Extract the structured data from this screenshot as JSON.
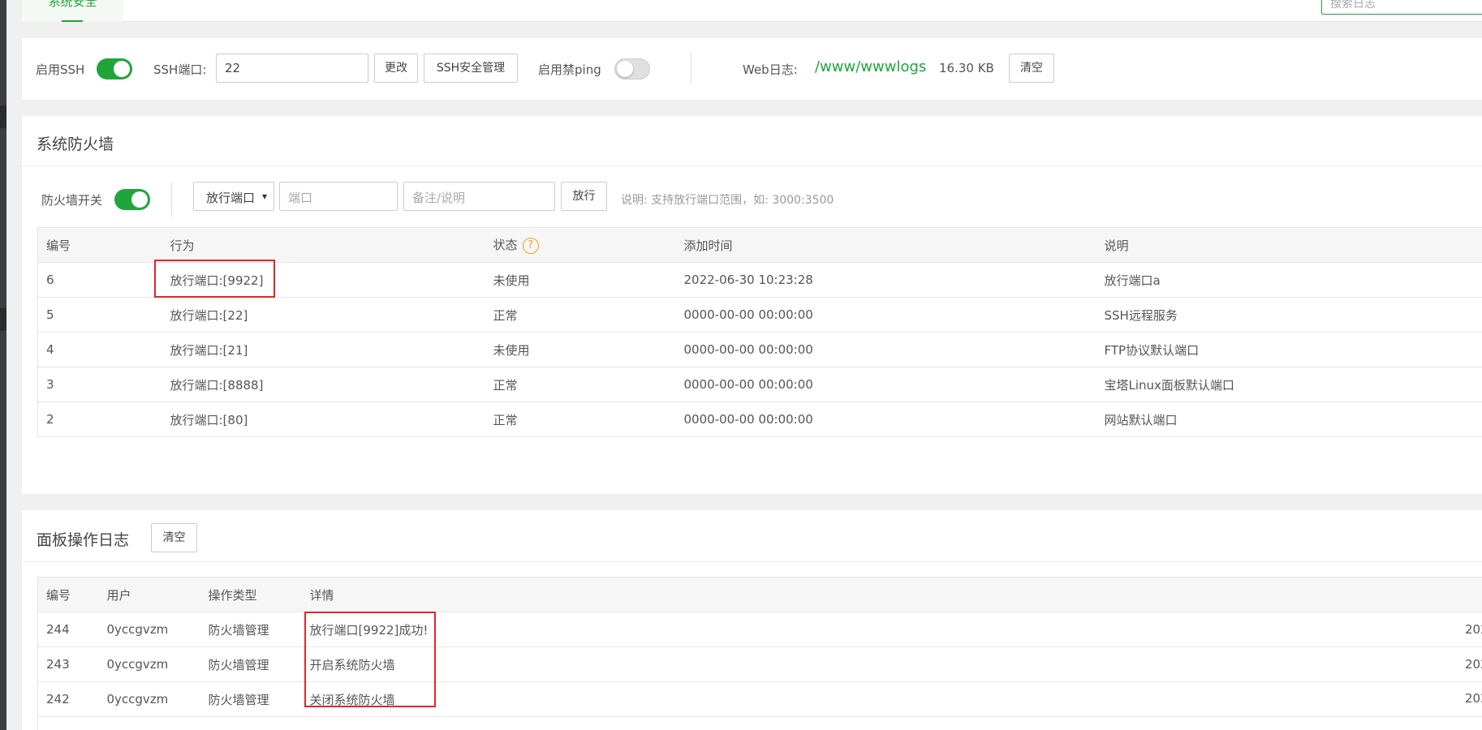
{
  "top": {
    "active_tab": "系统安全",
    "search_placeholder": "搜索日志"
  },
  "ssh": {
    "enable_ssh_label": "启用SSH",
    "ssh_enabled": true,
    "ssh_port_label": "SSH端口:",
    "ssh_port_value": "22",
    "change_button": "更改",
    "ssh_manage_button": "SSH安全管理",
    "ping_label": "启用禁ping",
    "ping_enabled": false,
    "web_log_label": "Web日志:",
    "web_log_path": "/www/wwwlogs",
    "web_log_size": "16.30 KB",
    "clear_button": "清空"
  },
  "firewall": {
    "title": "系统防火墙",
    "switch_label": "防火墙开关",
    "switch_enabled": true,
    "action_select": "放行端口",
    "port_placeholder": "端口",
    "note_placeholder": "备注/说明",
    "allow_button": "放行",
    "hint": "说明: 支持放行端口范围，如: 3000:3500",
    "columns": [
      "编号",
      "行为",
      "状态",
      "添加时间",
      "说明"
    ],
    "rows": [
      {
        "id": "6",
        "action": "放行端口:[9922]",
        "status": "未使用",
        "time": "2022-06-30 10:23:28",
        "note": "放行端口a"
      },
      {
        "id": "5",
        "action": "放行端口:[22]",
        "status": "正常",
        "time": "0000-00-00 00:00:00",
        "note": "SSH远程服务"
      },
      {
        "id": "4",
        "action": "放行端口:[21]",
        "status": "未使用",
        "time": "0000-00-00 00:00:00",
        "note": "FTP协议默认端口"
      },
      {
        "id": "3",
        "action": "放行端口:[8888]",
        "status": "正常",
        "time": "0000-00-00 00:00:00",
        "note": "宝塔Linux面板默认端口"
      },
      {
        "id": "2",
        "action": "放行端口:[80]",
        "status": "正常",
        "time": "0000-00-00 00:00:00",
        "note": "网站默认端口"
      }
    ]
  },
  "log": {
    "title": "面板操作日志",
    "clear_button": "清空",
    "columns": [
      "编号",
      "用户",
      "操作类型",
      "详情"
    ],
    "rows": [
      {
        "id": "244",
        "user": "0yccgvzm",
        "type": "防火墙管理",
        "detail": "放行端口[9922]成功!",
        "date": "202"
      },
      {
        "id": "243",
        "user": "0yccgvzm",
        "type": "防火墙管理",
        "detail": "开启系统防火墙",
        "date": "202"
      },
      {
        "id": "242",
        "user": "0yccgvzm",
        "type": "防火墙管理",
        "detail": "关闭系统防火墙",
        "date": "202"
      }
    ]
  },
  "colors": {
    "accent": "#20a53a",
    "highlight_box": "#e0262c",
    "help_icon": "#f0a020"
  }
}
